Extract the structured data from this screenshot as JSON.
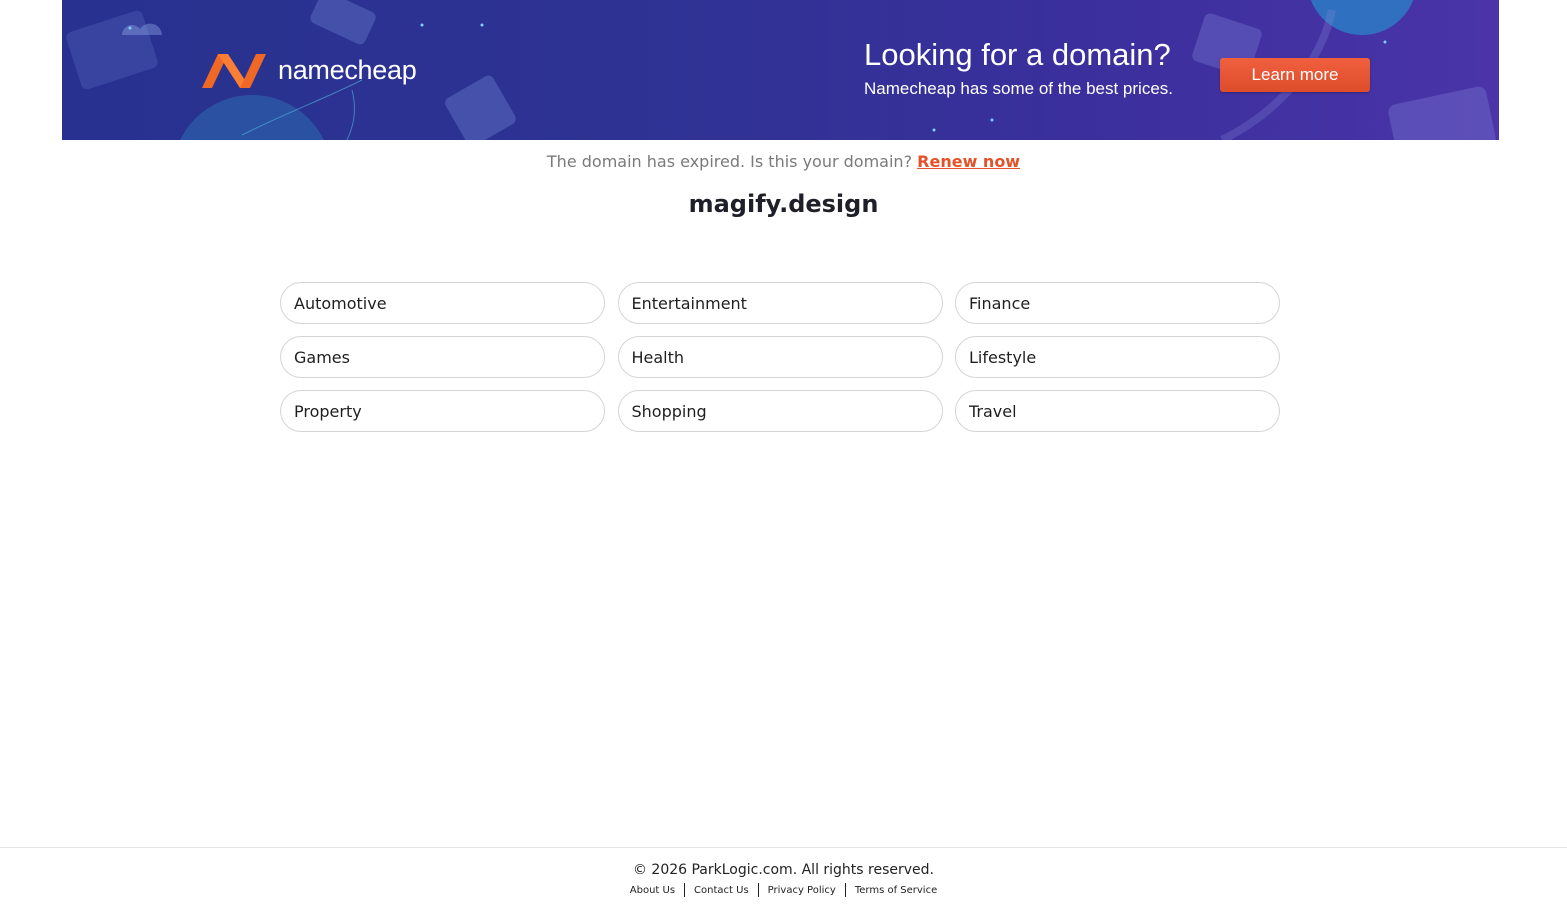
{
  "banner": {
    "brand": "namecheap",
    "title": "Looking for a domain?",
    "subtitle": "Namecheap has some of the best prices.",
    "cta_label": "Learn more",
    "colors": {
      "background": "#2e3393",
      "cta": "#e8552f",
      "logo_orange": "#fd6f2a"
    },
    "logo_icon": "namecheap-n-icon"
  },
  "notice": {
    "text": "The domain has expired. Is this your domain?",
    "link_label": "Renew now"
  },
  "domain": "magify.design",
  "categories": [
    "Automotive",
    "Entertainment",
    "Finance",
    "Games",
    "Health",
    "Lifestyle",
    "Property",
    "Shopping",
    "Travel"
  ],
  "footer": {
    "copyright": "© 2026 ParkLogic.com. All rights reserved.",
    "links": [
      "About Us",
      "Contact Us",
      "Privacy Policy",
      "Terms of Service"
    ]
  }
}
